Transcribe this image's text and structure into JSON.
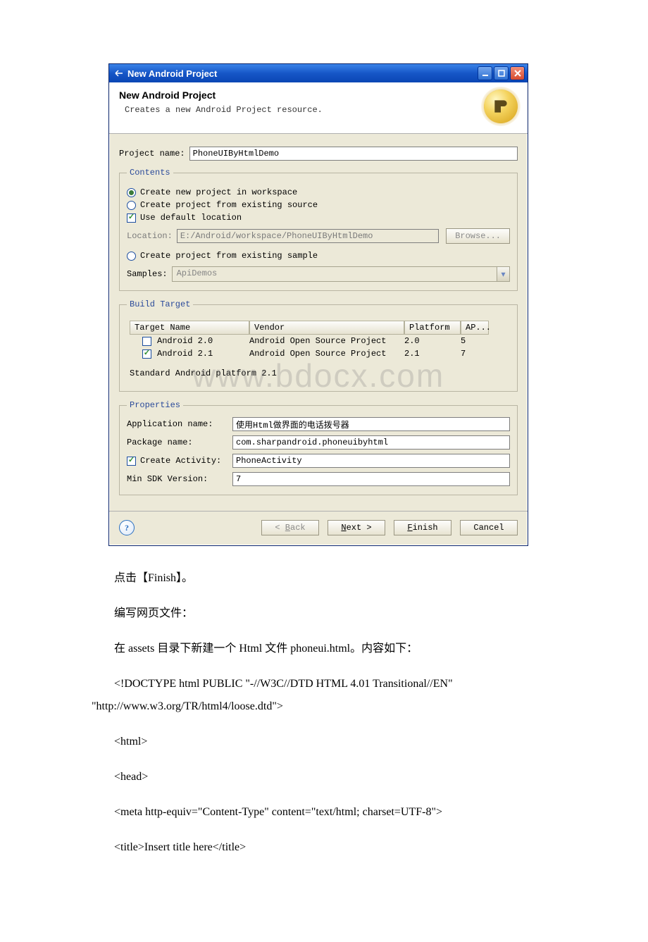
{
  "titlebar": {
    "title": "New Android Project"
  },
  "banner": {
    "heading": "New Android Project",
    "sub": "Creates a new Android Project resource."
  },
  "project_name": {
    "label": "Project name:",
    "value": "PhoneUIByHtmlDemo"
  },
  "contents": {
    "legend": "Contents",
    "opt_new": "Create new project in workspace",
    "opt_src": "Create project from existing source",
    "use_default": "Use default location",
    "location_label": "Location:",
    "location_value": "E:/Android/workspace/PhoneUIByHtmlDemo",
    "browse": "Browse...",
    "opt_sample": "Create project from existing sample",
    "samples_label": "Samples:",
    "samples_value": "ApiDemos"
  },
  "build": {
    "legend": "Build Target",
    "headers": {
      "name": "Target Name",
      "vendor": "Vendor",
      "platform": "Platform",
      "api": "AP..."
    },
    "rows": [
      {
        "checked": false,
        "name": "Android 2.0",
        "vendor": "Android Open Source Project",
        "platform": "2.0",
        "api": "5"
      },
      {
        "checked": true,
        "name": "Android 2.1",
        "vendor": "Android Open Source Project",
        "platform": "2.1",
        "api": "7"
      }
    ],
    "std_note": "Standard Android platform 2.1"
  },
  "props": {
    "legend": "Properties",
    "app_label": "Application name:",
    "app_value": "使用Html做界面的电话拨号器",
    "pkg_label": "Package name:",
    "pkg_value": "com.sharpandroid.phoneuibyhtml",
    "create_activity_label": "Create Activity:",
    "activity_value": "PhoneActivity",
    "minsdk_label": "Min SDK Version:",
    "minsdk_value": "7"
  },
  "footer": {
    "back": "< Back",
    "next": "Next >",
    "finish": "Finish",
    "cancel": "Cancel"
  },
  "watermark": "www.bdocx.com",
  "article": {
    "p1": "点击【Finish】。",
    "p2": "编写网页文件：",
    "p3": "在 assets 目录下新建一个 Html 文件 phoneui.html。内容如下：",
    "p4": "<!DOCTYPE html PUBLIC \"-//W3C//DTD HTML 4.01 Transitional//EN\" \"http://www.w3.org/TR/html4/loose.dtd\">",
    "p5": "<html>",
    "p6": "<head>",
    "p7": "<meta http-equiv=\"Content-Type\" content=\"text/html; charset=UTF-8\">",
    "p8": "<title>Insert title here</title>"
  }
}
